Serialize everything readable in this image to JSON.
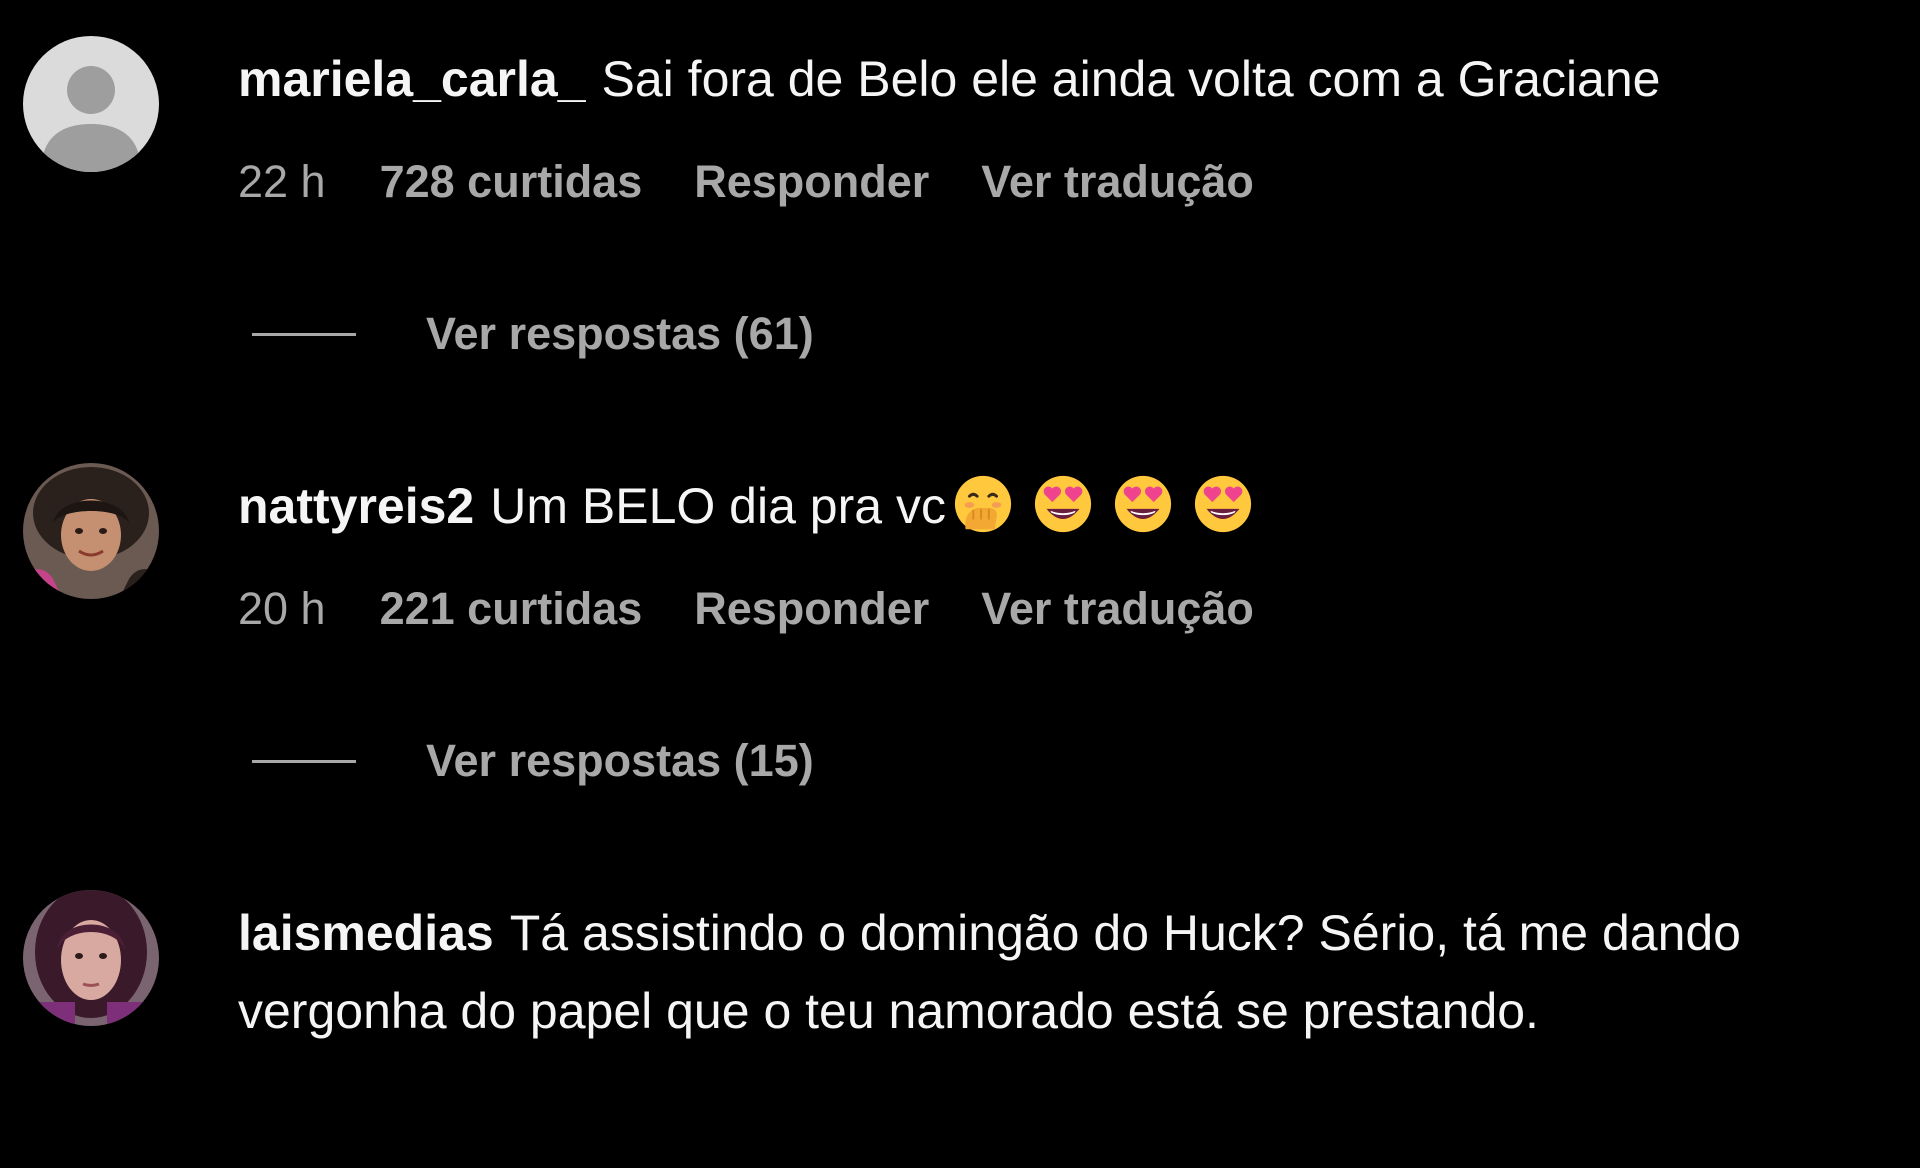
{
  "comments": [
    {
      "username": "mariela_carla_",
      "text": "Sai fora de Belo ele ainda volta com a Graciane",
      "time": "22 h",
      "likes": "728 curtidas",
      "reply_label": "Responder",
      "translate_label": "Ver tradução",
      "view_replies": "Ver respostas (61)",
      "avatar": "default-avatar"
    },
    {
      "username": "nattyreis2",
      "text": "Um BELO dia pra vc",
      "emojis": [
        "hand-over-mouth-emoji",
        "heart-eyes-emoji",
        "heart-eyes-emoji",
        "heart-eyes-emoji"
      ],
      "time": "20 h",
      "likes": "221 curtidas",
      "reply_label": "Responder",
      "translate_label": "Ver tradução",
      "view_replies": "Ver respostas (15)",
      "avatar": "photo-avatar"
    },
    {
      "username": "laismedias",
      "text": "Tá assistindo o domingão do Huck? Sério, tá me dando vergonha do papel que o teu namorado está se prestando.",
      "avatar": "photo-avatar"
    }
  ],
  "colors": {
    "background": "#000000",
    "primary_text": "#f5f5f5",
    "secondary_text": "#a8a8a8",
    "emoji_face": "#ffc83d",
    "emoji_heart": "#f0438e"
  }
}
